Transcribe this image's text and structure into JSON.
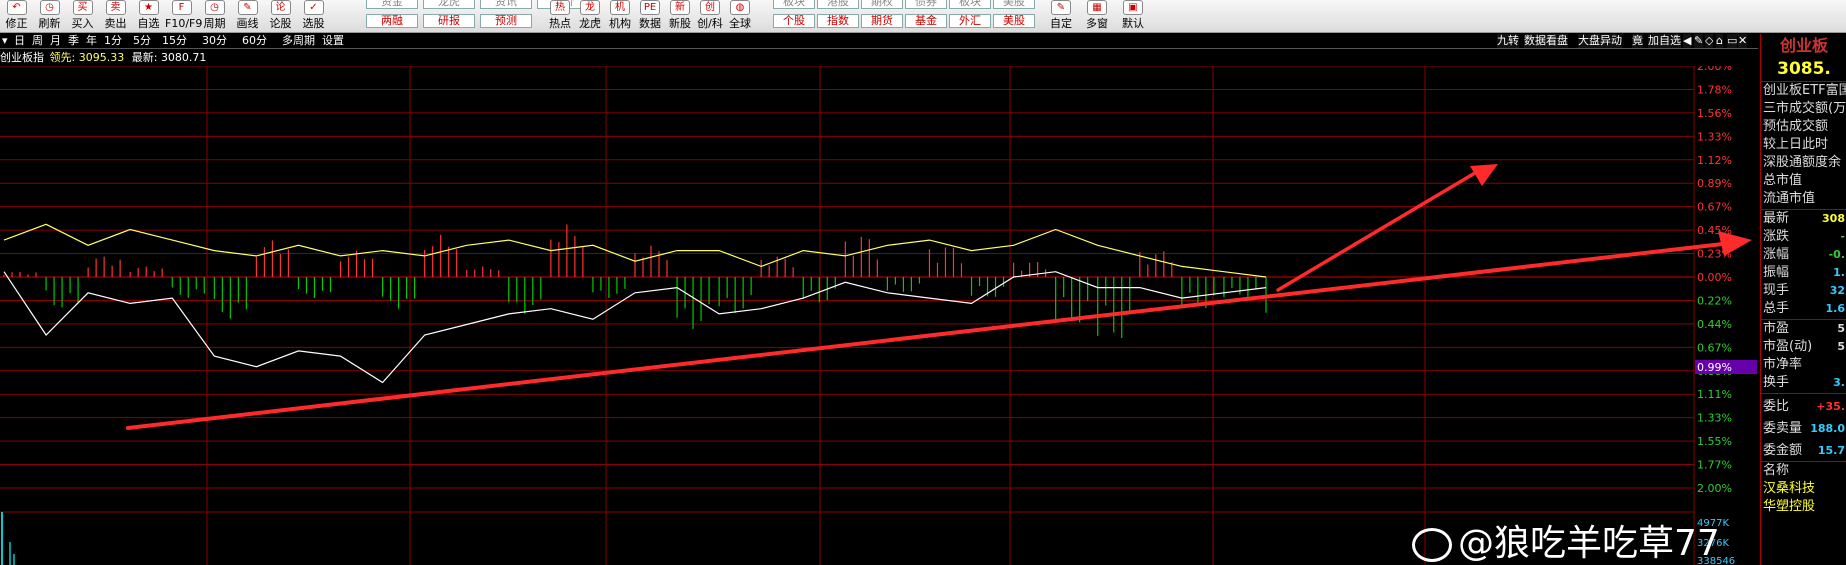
{
  "toolbar": {
    "items": [
      {
        "label": "修正",
        "icon": "undo-icon",
        "glyph": "↶"
      },
      {
        "label": "刷新",
        "icon": "refresh-icon",
        "glyph": "◷"
      },
      {
        "label": "买入",
        "icon": "buy-icon",
        "glyph": "买"
      },
      {
        "label": "卖出",
        "icon": "sell-icon",
        "glyph": "卖"
      },
      {
        "label": "自选",
        "icon": "favorite-star-icon",
        "glyph": "★"
      },
      {
        "label": "F10/F9",
        "icon": "f10-icon",
        "glyph": "F"
      },
      {
        "label": "周期",
        "icon": "period-clock-icon",
        "glyph": "◷"
      },
      {
        "label": "画线",
        "icon": "draw-line-icon",
        "glyph": "✎"
      },
      {
        "label": "论股",
        "icon": "forum-icon",
        "glyph": "论"
      },
      {
        "label": "选股",
        "icon": "stock-picker-icon",
        "glyph": "✓"
      }
    ],
    "pills_col1": {
      "top": "资金",
      "bottom": "两融"
    },
    "pills_col2": {
      "top": "龙虎",
      "bottom": "研报"
    },
    "pills_col3": {
      "top": "资讯",
      "bottom": "预测"
    },
    "pills_col4": {
      "top": "竞价",
      "bottom": ""
    },
    "items2": [
      {
        "label": "热点",
        "icon": "hot-icon",
        "glyph": "热"
      },
      {
        "label": "龙虎",
        "icon": "dragon-tiger-icon",
        "glyph": "龙"
      },
      {
        "label": "机构",
        "icon": "institution-icon",
        "glyph": "机"
      },
      {
        "label": "数据",
        "icon": "data-icon",
        "glyph": "PE"
      },
      {
        "label": "新股",
        "icon": "new-stock-icon",
        "glyph": "新"
      },
      {
        "label": "创/科",
        "icon": "chuang-icon",
        "glyph": "创"
      },
      {
        "label": "全球",
        "icon": "globe-icon",
        "glyph": "◍"
      }
    ],
    "pills2": [
      {
        "top": "板块",
        "bottom": "个股"
      },
      {
        "top": "港股",
        "bottom": "指数"
      },
      {
        "top": "期权",
        "bottom": "期货"
      },
      {
        "top": "债券",
        "bottom": "基金"
      },
      {
        "top": "板块",
        "bottom": "外汇"
      },
      {
        "top": "美股",
        "bottom": "美股"
      }
    ],
    "items3": [
      {
        "label": "自定",
        "icon": "custom-icon",
        "glyph": "✎"
      },
      {
        "label": "多窗",
        "icon": "multi-window-icon",
        "glyph": "▦"
      },
      {
        "label": "默认",
        "icon": "default-layout-icon",
        "glyph": "▣"
      }
    ]
  },
  "subbar": {
    "periods": [
      "日",
      "周",
      "月",
      "季",
      "年",
      "1分",
      "5分",
      "15分",
      "30分",
      "60分",
      "多周期",
      "设置"
    ],
    "right_buttons": [
      "九转",
      "数据看盘",
      "大盘异动",
      "竟",
      "加自选"
    ]
  },
  "info": {
    "name": "创业板指",
    "lead_label": "领先:",
    "lead_value": "3095.33",
    "latest_label": "最新:",
    "latest_value": "3080.71"
  },
  "colors": {
    "grid": "#8b0000",
    "up": "#ff3333",
    "down": "#00cc00",
    "white_line": "#ffffff",
    "yellow_line": "#ffff66",
    "trend_arrow": "#ff2a2a",
    "axis_text": "#ff3333",
    "price_box": "#6600aa"
  },
  "chart_data": {
    "type": "line",
    "title": "",
    "xlabel": "",
    "ylabel": "",
    "ylim": [
      -2.0,
      2.0
    ],
    "y_ticks_pos": [
      "2.00%",
      "1.78%",
      "1.56%",
      "1.33%",
      "1.12%",
      "0.89%",
      "0.67%",
      "0.45%",
      "0.23%",
      "0.00%"
    ],
    "y_ticks_neg": [
      "0.22%",
      "0.44%",
      "0.67%",
      "0.88%",
      "1.11%",
      "1.33%",
      "1.55%",
      "1.77%",
      "2.00%"
    ],
    "current_price_box": "0.99%",
    "volume_ticks": [
      "4977K",
      "3276K",
      "338546"
    ],
    "x": [
      0,
      8,
      16,
      24,
      32,
      40,
      48,
      56,
      64,
      72,
      80,
      88,
      96,
      104,
      112,
      120,
      128,
      136,
      144,
      152,
      160,
      168,
      176,
      184,
      192,
      200,
      208,
      216,
      224,
      232,
      240
    ],
    "series": [
      {
        "values": [
          0.05,
          -0.55,
          -0.15,
          -0.25,
          -0.2,
          -0.75,
          -0.85,
          -0.7,
          -0.75,
          -1.0,
          -0.55,
          -0.45,
          -0.35,
          -0.3,
          -0.4,
          -0.15,
          -0.1,
          -0.35,
          -0.3,
          -0.2,
          -0.05,
          -0.15,
          -0.2,
          -0.25,
          0.0,
          0.05,
          -0.1,
          -0.1,
          -0.2,
          -0.15,
          -0.1
        ]
      },
      {
        "values": [
          0.35,
          0.5,
          0.3,
          0.45,
          0.35,
          0.25,
          0.2,
          0.3,
          0.2,
          0.25,
          0.2,
          0.3,
          0.35,
          0.25,
          0.3,
          0.15,
          0.25,
          0.25,
          0.1,
          0.25,
          0.2,
          0.3,
          0.35,
          0.25,
          0.3,
          0.45,
          0.3,
          0.2,
          0.1,
          0.05,
          0.0
        ]
      }
    ],
    "bars": [
      0.05,
      -0.3,
      0.2,
      0.1,
      -0.2,
      -0.4,
      0.35,
      -0.2,
      0.25,
      -0.3,
      0.4,
      0.1,
      -0.35,
      0.5,
      -0.2,
      0.3,
      -0.5,
      -0.35,
      0.2,
      -0.25,
      0.4,
      -0.15,
      0.3,
      -0.2,
      0.15,
      -0.45,
      -0.6,
      0.25,
      -0.3,
      -0.2,
      -0.35
    ]
  },
  "right_panel": {
    "title": "创业板",
    "price": "3085.",
    "rows": [
      "创业板ETF富国",
      "三市成交额(万",
      "预估成交额",
      "较上日此时",
      "深股通额度余",
      "总市值",
      "流通市值"
    ],
    "quote_rows": [
      {
        "k": "最新",
        "v": "308",
        "c": "#ffff33"
      },
      {
        "k": "涨跌",
        "v": "-",
        "c": "#33cc33"
      },
      {
        "k": "涨幅",
        "v": "-0.",
        "c": "#33cc33"
      },
      {
        "k": "振幅",
        "v": "1.",
        "c": "#33ccff"
      },
      {
        "k": "现手",
        "v": "32",
        "c": "#33ccff"
      },
      {
        "k": "总手",
        "v": "1.6",
        "c": "#33ccff"
      }
    ],
    "val_rows": [
      {
        "k": "市盈",
        "v": "5",
        "c": "#ddd"
      },
      {
        "k": "市盈(动)",
        "v": "5",
        "c": "#ddd"
      },
      {
        "k": "市净率",
        "v": "",
        "c": "#ddd"
      },
      {
        "k": "换手",
        "v": "3.",
        "c": "#33ccff"
      }
    ],
    "bottom_rows": [
      {
        "k": "委比",
        "v": "+35.",
        "c": "#ff3333"
      },
      {
        "k": "委卖量",
        "v": "188.0",
        "c": "#33ccff"
      },
      {
        "k": "委金额",
        "v": "15.7",
        "c": "#33ccff"
      }
    ],
    "list_header": "名称",
    "list_items": [
      "汉桑科技",
      "华塑控股"
    ]
  },
  "watermark": {
    "text": "@狼吃羊吃草77"
  }
}
